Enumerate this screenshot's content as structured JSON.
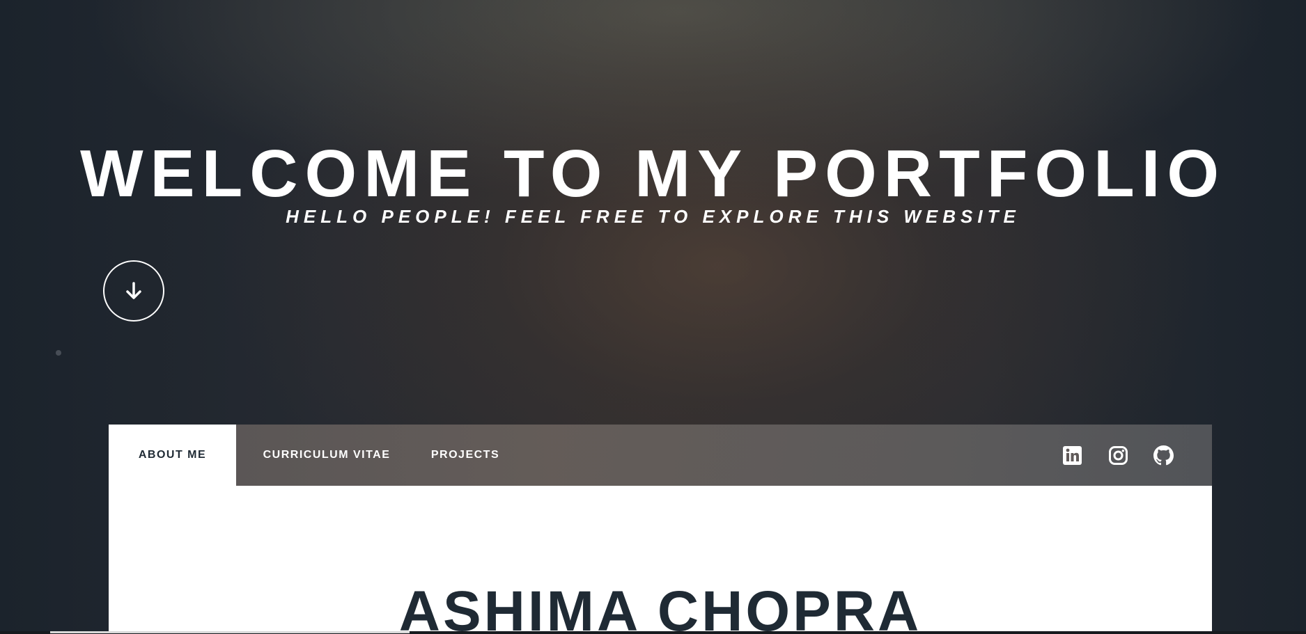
{
  "hero": {
    "title": "WELCOME TO MY PORTFOLIO",
    "subtitle": "HELLO PEOPLE! FEEL FREE TO EXPLORE THIS WEBSITE",
    "scroll_icon": "arrow-down-icon"
  },
  "nav": {
    "tabs": [
      {
        "label": "ABOUT ME",
        "active": true
      },
      {
        "label": "CURRICULUM VITAE",
        "active": false
      },
      {
        "label": "PROJECTS",
        "active": false
      }
    ],
    "social_icons": [
      "linkedin-icon",
      "instagram-icon",
      "github-icon"
    ]
  },
  "about": {
    "name": "ASHIMA CHOPRA"
  },
  "colors": {
    "text_dark": "#1f2a34",
    "text_light": "#ffffff",
    "nav_background": "#605a59"
  }
}
